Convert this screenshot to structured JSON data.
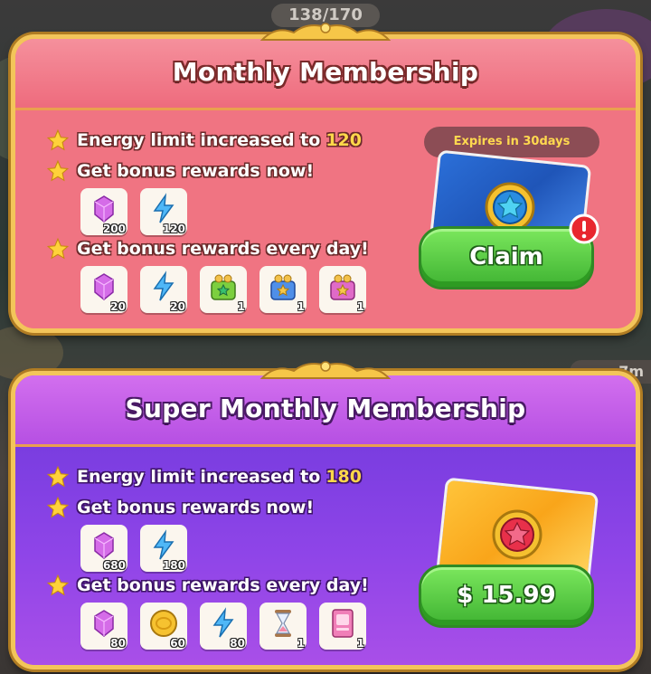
{
  "background": {
    "counter": "138/170",
    "timer": "7m"
  },
  "monthly": {
    "title": "Monthly Membership",
    "perks": [
      {
        "text": "Energy limit increased to",
        "highlight": "120"
      },
      {
        "text": "Get bonus rewards now!"
      },
      {
        "text": "Get bonus rewards every day!"
      }
    ],
    "now_rewards": [
      {
        "icon": "gem-icon",
        "count": "200"
      },
      {
        "icon": "energy-icon",
        "count": "120"
      }
    ],
    "daily_rewards": [
      {
        "icon": "gem-icon",
        "count": "20"
      },
      {
        "icon": "energy-icon",
        "count": "20"
      },
      {
        "icon": "green-chest-icon",
        "count": "1"
      },
      {
        "icon": "blue-chest-icon",
        "count": "1"
      },
      {
        "icon": "pink-chest-icon",
        "count": "1"
      }
    ],
    "expires": "Expires in 30days",
    "button": "Claim"
  },
  "super": {
    "title": "Super Monthly Membership",
    "perks": [
      {
        "text": "Energy limit increased to",
        "highlight": "180"
      },
      {
        "text": "Get bonus rewards now!"
      },
      {
        "text": "Get bonus rewards every day!"
      }
    ],
    "now_rewards": [
      {
        "icon": "gem-icon",
        "count": "680"
      },
      {
        "icon": "energy-icon",
        "count": "180"
      }
    ],
    "daily_rewards": [
      {
        "icon": "gem-icon",
        "count": "80"
      },
      {
        "icon": "coin-icon",
        "count": "60"
      },
      {
        "icon": "energy-icon",
        "count": "80"
      },
      {
        "icon": "hourglass-icon",
        "count": "1"
      },
      {
        "icon": "card-icon",
        "count": "1"
      }
    ],
    "button": "$ 15.99"
  },
  "colors": {
    "monthly_panel": "#f26f7e",
    "super_panel": "#9a4ce8",
    "gold_border": "#f3c55a",
    "button_green": "#4fc23e",
    "highlight_yellow": "#ffd84a"
  }
}
